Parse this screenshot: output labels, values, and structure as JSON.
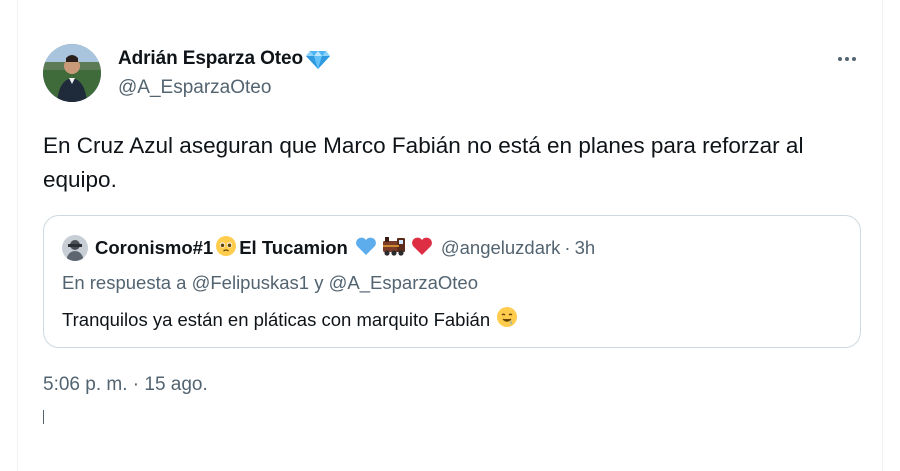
{
  "author": {
    "name": "Adrián Esparza Oteo",
    "handle": "@A_EsparzaOteo",
    "verified_badge_icon": "blue-diamond-icon"
  },
  "tweet": {
    "text": "En Cruz Azul aseguran que Marco Fabián no está en planes para reforzar al equipo.",
    "timestamp": "5:06 p. m. · 15 ago."
  },
  "more_menu_icon": "three-dots-icon",
  "quote": {
    "name": "Coronismo#1",
    "name_suffix": "El Tucamion",
    "name_emojis": [
      "pleading-face-icon",
      "blue-heart-icon",
      "train-icon",
      "red-heart-icon"
    ],
    "handle": "@angeluzdark",
    "separator": "·",
    "time": "3h",
    "reply_prefix": "En respuesta a",
    "reply_user1": "@Felipuskas1",
    "reply_join": "y",
    "reply_user2": "@A_EsparzaOteo",
    "text": "Tranquilos ya están en pláticas con marquito Fabián",
    "text_emoji": "drooling-face-icon"
  },
  "colors": {
    "text_primary": "#0f1419",
    "text_secondary": "#536471",
    "border": "#cfd9de",
    "verified": "#1d9bf0"
  }
}
